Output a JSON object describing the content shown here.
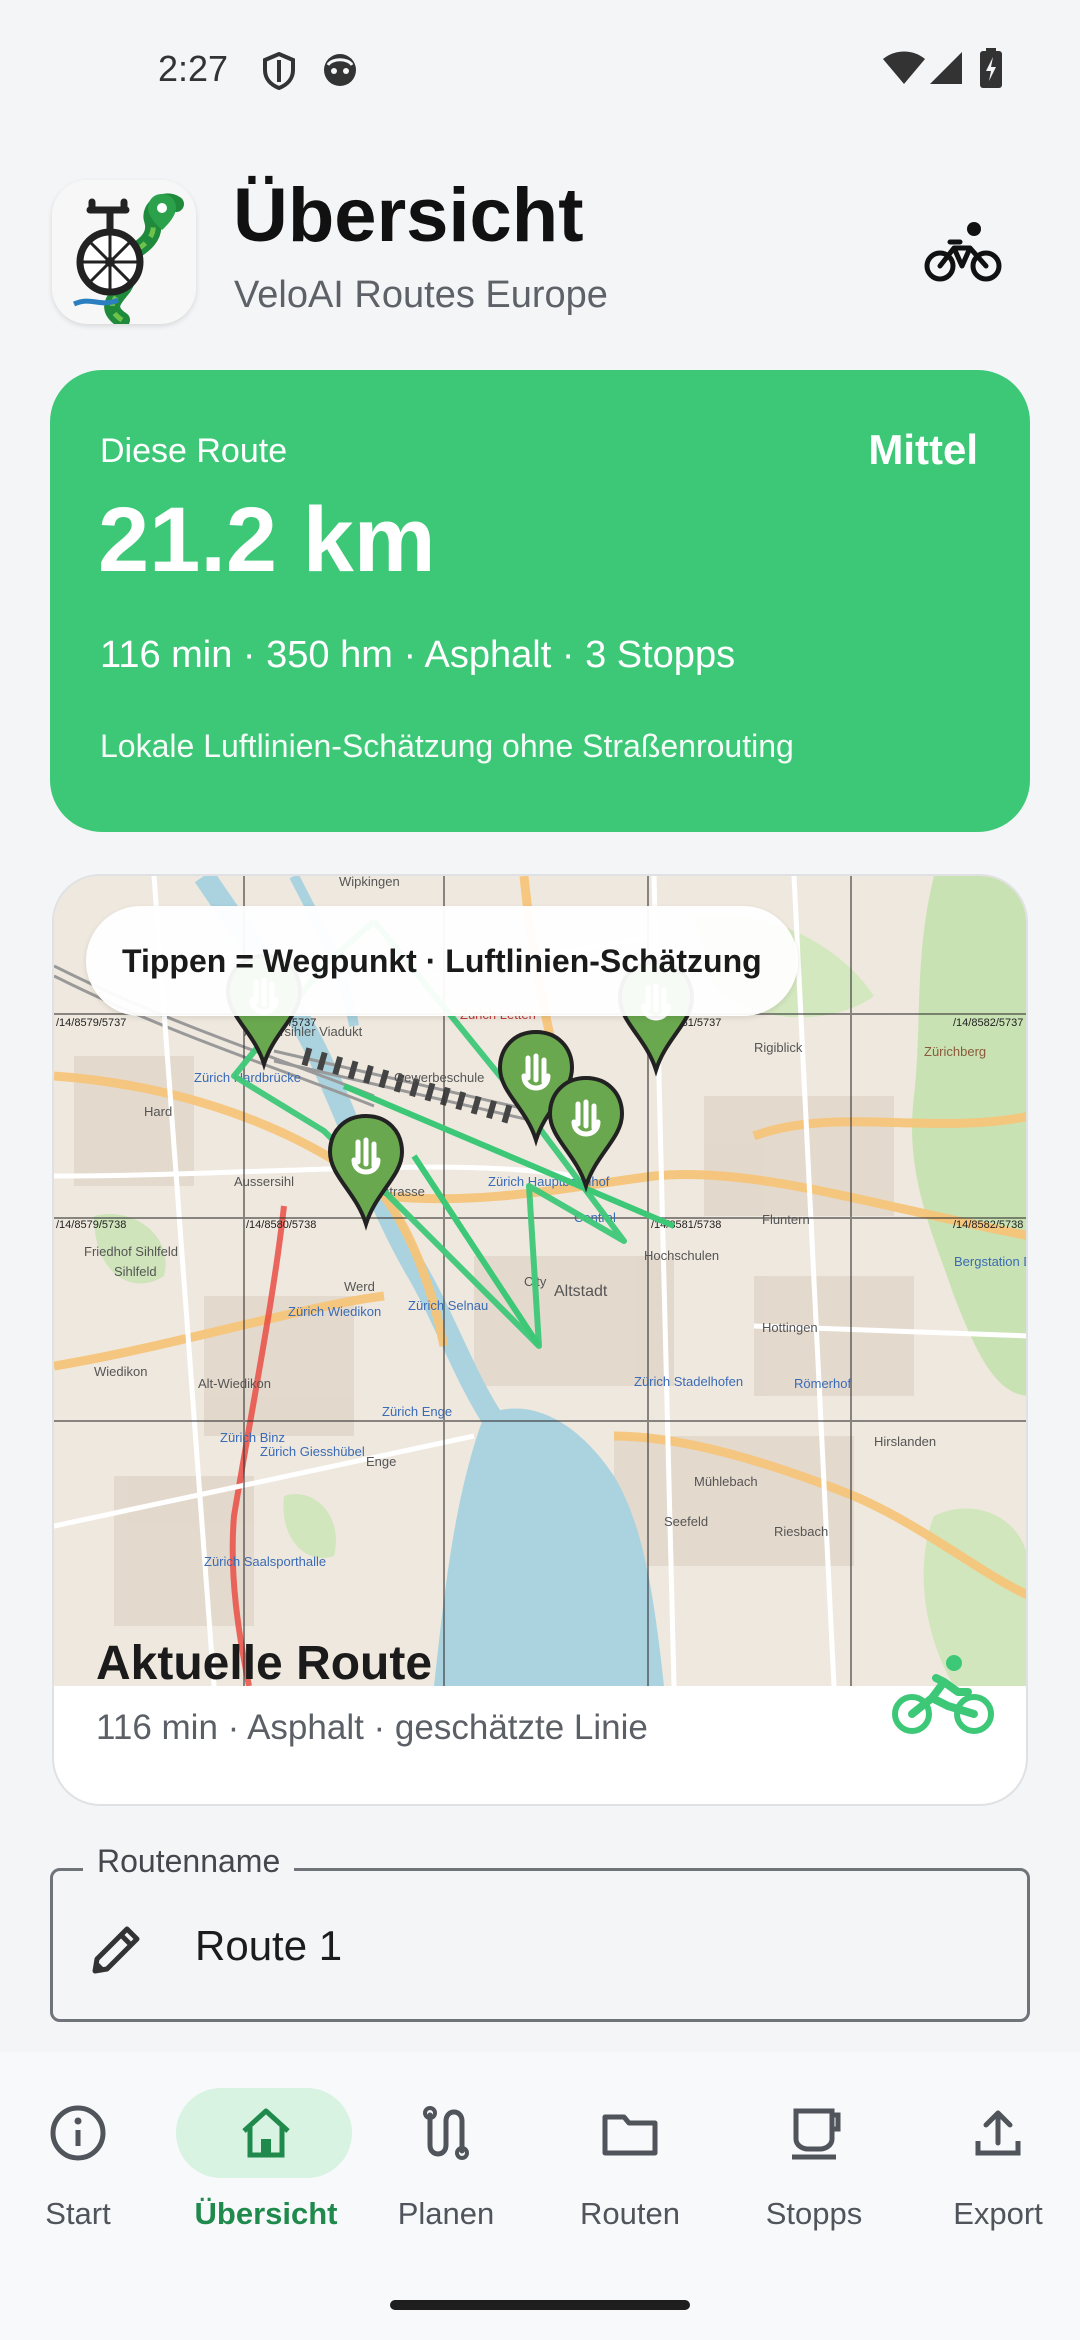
{
  "status_bar": {
    "time": "2:27"
  },
  "header": {
    "title": "Übersicht",
    "subtitle": "VeloAI Routes Europe"
  },
  "summary": {
    "label": "Diese Route",
    "level": "Mittel",
    "distance": "21.2 km",
    "stats": "116 min · 350 hm · Asphalt · 3 Stopps",
    "note": "Lokale Luftlinien-Schätzung ohne Straßenrouting",
    "color": "#3dc878"
  },
  "map": {
    "tip": "Tippen = Wegpunkt · Luftlinien-Schätzung",
    "route_title": "Aktuelle Route",
    "route_meta": "116 min · Asphalt · geschätzte Linie",
    "route_color": "#3dc878",
    "place_labels": [
      "Wipkingen",
      "Aussersihler Viadukt",
      "Zürich Hardbrücke",
      "Hard",
      "Gewerbeschule",
      "Zürich Letten",
      "Rigiblick",
      "Aussersihl",
      "Langstrasse",
      "Zürich Hauptbahnhof",
      "Central",
      "Hochschulen",
      "Fluntern",
      "Friedhof Sihlfeld",
      "Sihlfeld",
      "Werd",
      "City",
      "Altstadt",
      "Zürich Selnau",
      "Zürich Wiedikon",
      "Hottingen",
      "Wiedikon",
      "Alt-Wiedikon",
      "Römerhof",
      "Zürich Stadelhofen",
      "Zürich Enge",
      "Enge",
      "Hirslanden",
      "Zürich Binz",
      "Zürich Giesshübel",
      "Mühlebach",
      "Seefeld",
      "Riesbach",
      "Zürich Saalsporthalle",
      "Zürichberg",
      "Bergstation Dolderbahn"
    ],
    "tile_labels": [
      "/14/8579/5737",
      "/14/8580/5737",
      "/14/8581/5737",
      "/14/8582/5737",
      "/14/8579/5738",
      "/14/8580/5738",
      "/14/8581/5738",
      "/14/8582/5738"
    ]
  },
  "form": {
    "route_name_label": "Routenname",
    "route_name_value": "Route 1"
  },
  "nav": {
    "items": [
      {
        "label": "Start",
        "icon": "info-icon"
      },
      {
        "label": "Übersicht",
        "icon": "home-icon",
        "active": true
      },
      {
        "label": "Planen",
        "icon": "route-icon"
      },
      {
        "label": "Routen",
        "icon": "folder-icon"
      },
      {
        "label": "Stopps",
        "icon": "coffee-icon"
      },
      {
        "label": "Export",
        "icon": "upload-icon"
      }
    ]
  },
  "colors": {
    "accent": "#3dc878",
    "accent_dark": "#1f8a4c",
    "nav_active_bg": "#d8f3e2"
  }
}
